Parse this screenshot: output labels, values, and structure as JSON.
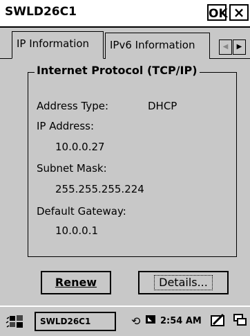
{
  "window": {
    "title": "SWLD26C1",
    "ok_label": "OK",
    "close_label": "×"
  },
  "tabs": [
    {
      "label": "IP Information",
      "active": true
    },
    {
      "label": "IPv6 Information",
      "active": false
    }
  ],
  "tab_scroll": {
    "left_icon": "◀",
    "right_icon": "▶"
  },
  "group": {
    "title": "Internet Protocol (TCP/IP)",
    "address_type_label": "Address Type:",
    "address_type_value": "DHCP",
    "ip_label": "IP Address:",
    "ip_value": "10.0.0.27",
    "subnet_label": "Subnet Mask:",
    "subnet_value": "255.255.255.224",
    "gateway_label": "Default Gateway:",
    "gateway_value": "10.0.0.1"
  },
  "buttons": {
    "renew_label": "Renew",
    "details_label": "Details..."
  },
  "taskbar": {
    "start_icon": "windows-flag-icon",
    "app_label": "SWLD26C1",
    "clock": "2:54 AM",
    "tray_icons": [
      "sync-icon",
      "connection-icon",
      "input-panel-icon",
      "desktop-icon"
    ]
  }
}
